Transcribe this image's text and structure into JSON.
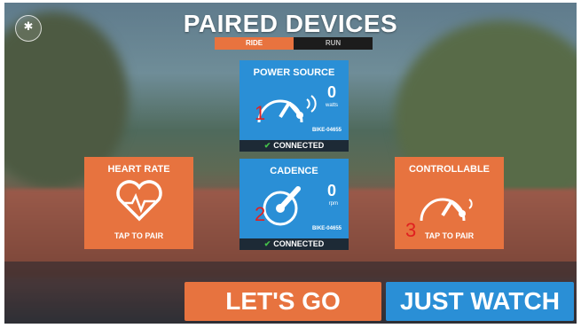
{
  "header": {
    "title": "PAIRED DEVICES"
  },
  "bluetooth": {
    "icon": "bluetooth-icon",
    "glyph": "✱"
  },
  "sport_toggle": {
    "options": [
      "RIDE",
      "RUN"
    ],
    "selected": "RIDE"
  },
  "tiles": {
    "power": {
      "label": "POWER SOURCE",
      "value": "0",
      "unit": "watts",
      "device_id": "BIKE-04655",
      "status": "CONNECTED",
      "marker": "1"
    },
    "heart": {
      "label": "HEART RATE",
      "status": "TAP TO PAIR"
    },
    "cadence": {
      "label": "CADENCE",
      "value": "0",
      "unit": "rpm",
      "device_id": "BIKE-04655",
      "status": "CONNECTED",
      "marker": "2"
    },
    "controllable": {
      "label": "CONTROLLABLE",
      "status": "TAP TO PAIR",
      "marker": "3"
    }
  },
  "buttons": {
    "lets_go": "LET'S GO",
    "just_watch": "JUST WATCH"
  },
  "colors": {
    "orange": "#e7733f",
    "blue": "#2a8fd6",
    "connected_bar": "#1d2a36",
    "check": "#44c04a",
    "marker": "#e02020"
  }
}
